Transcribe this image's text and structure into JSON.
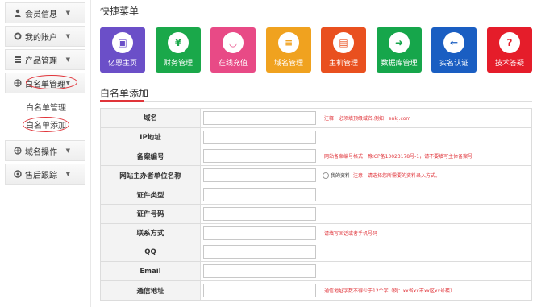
{
  "sidebar": {
    "items": [
      {
        "label": "会员信息",
        "icon": "user-icon"
      },
      {
        "label": "我的账户",
        "icon": "gear-icon"
      },
      {
        "label": "产品管理",
        "icon": "list-icon"
      },
      {
        "label": "白名单管理",
        "icon": "globe-icon"
      }
    ],
    "subitems": [
      {
        "label": "白名单管理"
      },
      {
        "label": "白名单添加"
      }
    ],
    "items_after": [
      {
        "label": "域名操作",
        "icon": "globe-icon"
      },
      {
        "label": "售后跟踪",
        "icon": "support-icon"
      }
    ]
  },
  "quick": {
    "title": "快捷菜单",
    "tiles": [
      {
        "label": "亿恩主页",
        "color": "#6b4fc8",
        "glyph": "▣"
      },
      {
        "label": "财务管理",
        "color": "#1aa84a",
        "glyph": "¥"
      },
      {
        "label": "在线充值",
        "color": "#e84a86",
        "glyph": "◡"
      },
      {
        "label": "域名管理",
        "color": "#f0a21f",
        "glyph": "≡"
      },
      {
        "label": "主机管理",
        "color": "#e9501f",
        "glyph": "▤"
      },
      {
        "label": "数据库管理",
        "color": "#16a64b",
        "glyph": "➜"
      },
      {
        "label": "实名认证",
        "color": "#1a5ec2",
        "glyph": "⇐"
      },
      {
        "label": "技术答疑",
        "color": "#e51d2a",
        "glyph": "?"
      }
    ]
  },
  "form": {
    "title": "白名单添加",
    "rows": [
      {
        "label": "域名",
        "note": "注释：必须填顶级域名,例如：enkj.com"
      },
      {
        "label": "IP地址",
        "note": ""
      },
      {
        "label": "备案编号",
        "note": "网站备案编号格式：豫ICP备13023178号-1，请不要填写主体备案号"
      },
      {
        "label": "网站主办者单位名称",
        "note": "注意：请选择您所需要的资料录入方式。",
        "radio": "我的资料"
      },
      {
        "label": "证件类型",
        "note": ""
      },
      {
        "label": "证件号码",
        "note": ""
      },
      {
        "label": "联系方式",
        "note": "请填写固话或者手机号码"
      },
      {
        "label": "QQ",
        "note": ""
      },
      {
        "label": "Email",
        "note": ""
      },
      {
        "label": "通信地址",
        "note": "通信地址字数不得少于12个字（例：xx省xx市xx区xx号楼）"
      }
    ]
  }
}
